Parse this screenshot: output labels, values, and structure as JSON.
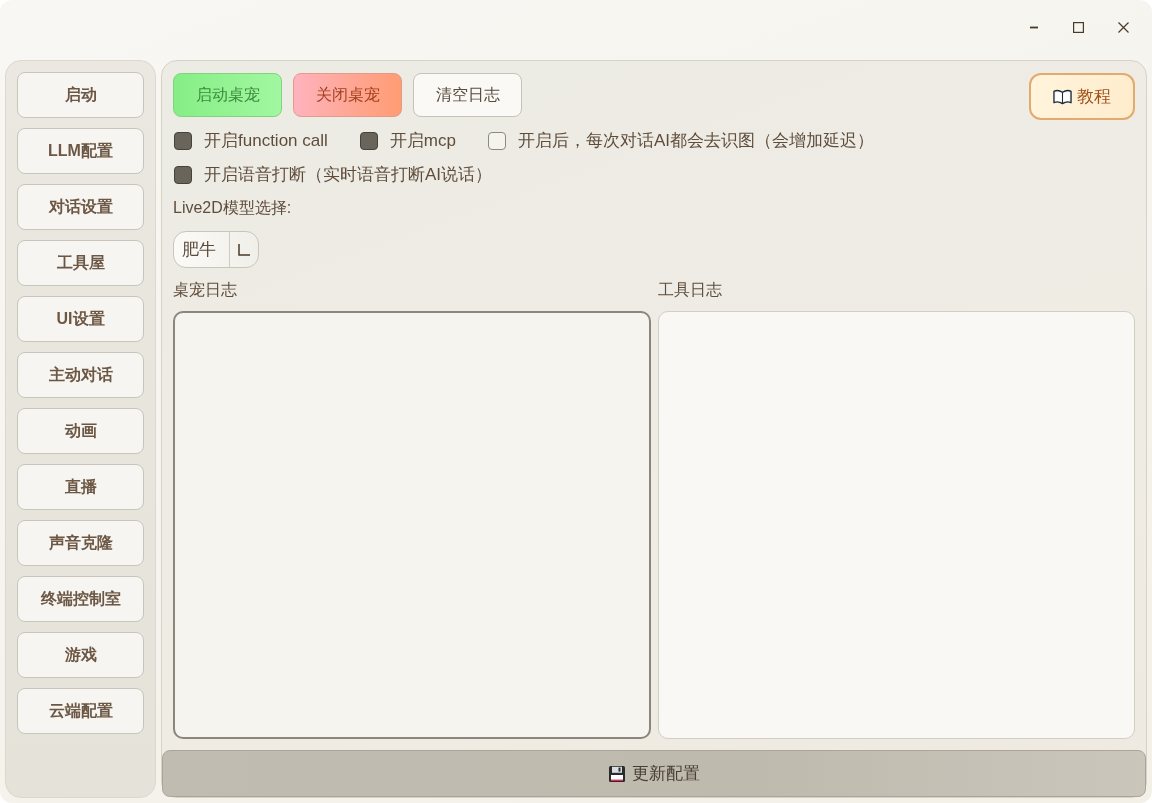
{
  "window": {
    "controls": [
      {
        "kind": "minimize"
      },
      {
        "kind": "maximize"
      },
      {
        "kind": "close"
      }
    ]
  },
  "sidebar": {
    "items": [
      {
        "label": "启动"
      },
      {
        "label": "LLM配置"
      },
      {
        "label": "对话设置"
      },
      {
        "label": "工具屋"
      },
      {
        "label": "UI设置"
      },
      {
        "label": "主动对话"
      },
      {
        "label": "动画"
      },
      {
        "label": "直播"
      },
      {
        "label": "声音克隆"
      },
      {
        "label": "终端控制室"
      },
      {
        "label": "游戏"
      },
      {
        "label": "云端配置"
      }
    ]
  },
  "toolbar": {
    "buttons": [
      {
        "label": "启动桌宠",
        "kind": "start"
      },
      {
        "label": "关闭桌宠",
        "kind": "stop"
      },
      {
        "label": "清空日志",
        "kind": "plain"
      }
    ],
    "tutorial_button": {
      "label": "教程"
    }
  },
  "option_rows": [
    [
      {
        "label": "开启function call",
        "checked": true
      },
      {
        "label": "开启mcp",
        "checked": true
      },
      {
        "label": "开启后，每次对话AI都会去识图（会增加延迟）",
        "checked": false
      }
    ],
    [
      {
        "label": "开启语音打断（实时语音打断AI说话）",
        "checked": true
      }
    ]
  ],
  "model_select": {
    "label": "Live2D模型选择:",
    "value": "肥牛"
  },
  "logs": [
    {
      "title": "桌宠日志",
      "focused": true
    },
    {
      "title": "工具日志",
      "focused": false
    }
  ],
  "update_button": {
    "label": "更新配置"
  }
}
